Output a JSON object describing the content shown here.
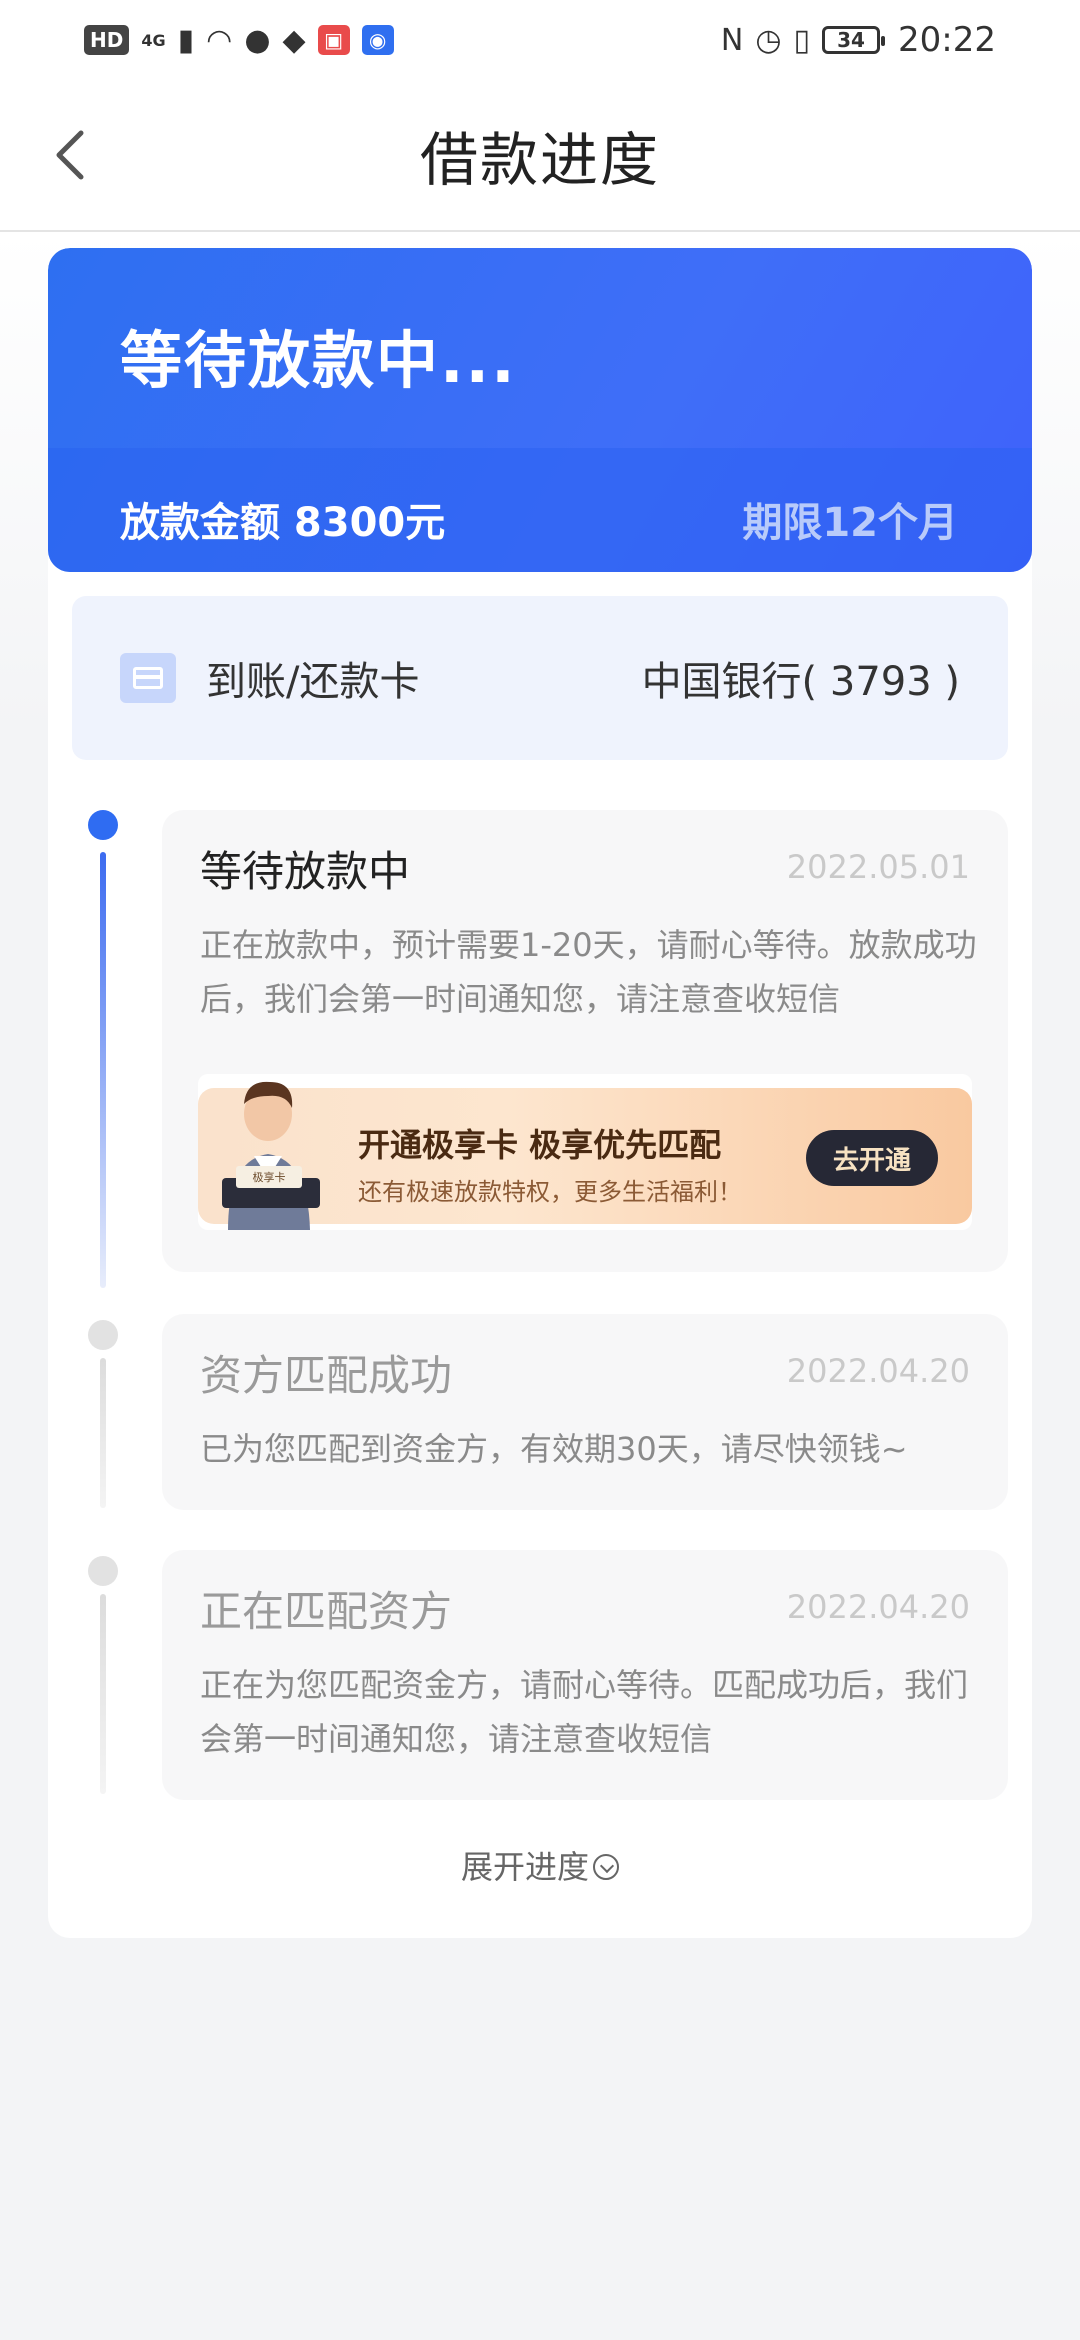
{
  "status_bar": {
    "hd": "HD",
    "network": "4G",
    "battery": "34",
    "time": "20:22"
  },
  "header": {
    "title": "借款进度"
  },
  "hero": {
    "status": "等待放款中...",
    "amount": "放款金额 8300元",
    "term": "期限12个月",
    "accent_color": "#3b6cf6"
  },
  "bank_card": {
    "label": "到账/还款卡",
    "value": "中国银行( 3793 )"
  },
  "timeline": [
    {
      "title": "等待放款中",
      "date": "2022.05.01",
      "desc": "正在放款中，预计需要1-20天，请耐心等待。放款成功后，我们会第一时间通知您，请注意查收短信",
      "state": "active"
    },
    {
      "title": "资方匹配成功",
      "date": "2022.04.20",
      "desc": "已为您匹配到资金方，有效期30天，请尽快领钱~",
      "state": "inactive"
    },
    {
      "title": "正在匹配资方",
      "date": "2022.04.20",
      "desc": "正在为您匹配资金方，请耐心等待。匹配成功后，我们会第一时间通知您，请注意查收短信",
      "state": "inactive"
    }
  ],
  "promo": {
    "title": "开通极享卡  极享优先匹配",
    "subtitle": "还有极速放款特权，更多生活福利！",
    "button": "去开通",
    "card_text": "极享卡"
  },
  "expand_label": "展开进度"
}
